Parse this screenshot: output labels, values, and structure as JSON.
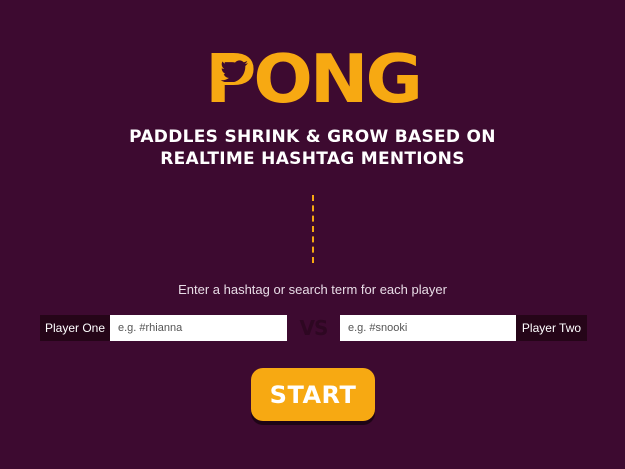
{
  "logo": {
    "text": "PONG",
    "icon": "twitter-bird-icon"
  },
  "tagline": "PADDLES SHRINK & GROW BASED ON\nREALTIME HASHTAG MENTIONS",
  "instruction": "Enter a hashtag or search term for each player",
  "player_one": {
    "label": "Player One",
    "placeholder": "e.g. #rhianna",
    "value": ""
  },
  "vs_label": "VS",
  "player_two": {
    "label": "Player Two",
    "placeholder": "e.g. #snooki",
    "value": ""
  },
  "start_label": "START",
  "colors": {
    "background": "#3d0a30",
    "accent": "#f7a912",
    "label_bg": "#250518"
  }
}
